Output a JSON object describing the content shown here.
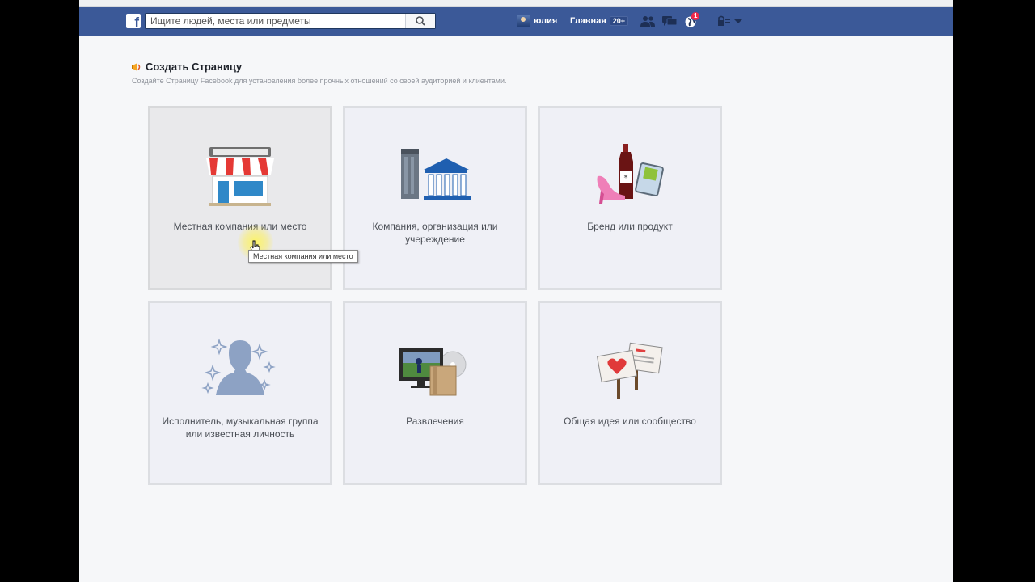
{
  "topbar": {
    "search_placeholder": "Ищите людей, места или предметы",
    "user_name": "юлия",
    "home_label": "Главная",
    "home_count": "20+",
    "notifications_count": "1"
  },
  "page": {
    "title": "Создать Страницу",
    "subtitle": "Создайте Страницу Facebook для установления более прочных отношений со своей аудиторией и клиентами."
  },
  "categories": [
    {
      "label": "Местная компания или место",
      "icon": "storefront-icon"
    },
    {
      "label": "Компания, организация или учереждение",
      "icon": "building-icon"
    },
    {
      "label": "Бренд или продукт",
      "icon": "brand-products-icon"
    },
    {
      "label": "Исполнитель, музыкальная группа или известная личность",
      "icon": "artist-silhouette-icon"
    },
    {
      "label": "Развлечения",
      "icon": "entertainment-icon"
    },
    {
      "label": "Общая идея или сообщество",
      "icon": "community-signs-icon"
    }
  ],
  "tooltip": "Местная компания или место",
  "colors": {
    "facebook_blue": "#3b5998",
    "tile_bg": "#eff0f6",
    "tile_border": "#dcdee2"
  }
}
